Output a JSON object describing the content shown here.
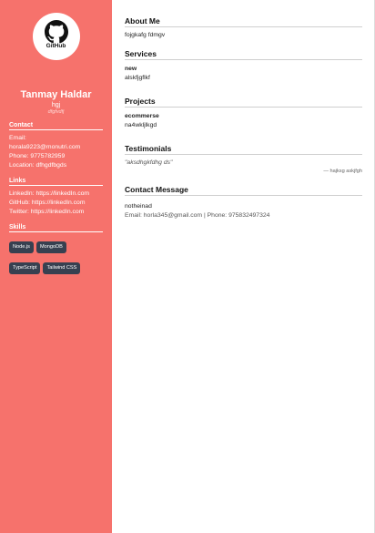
{
  "logo": {
    "text": "GitHub"
  },
  "profile": {
    "name": "Tanmay Haldar",
    "handle": "hgj",
    "subtitle": "dfgfvdfj"
  },
  "contact": {
    "heading": "Contact",
    "email_label": "Email:",
    "email": "horala9223@monutri.com",
    "phone": "Phone: 9775782959",
    "location": "Location: dfhgdfbgds"
  },
  "links": {
    "heading": "Links",
    "linkedin": "LinkedIn: https://linkedIn.com",
    "github": "GitHub: https://linkedIn.com",
    "twitter": "Twitter: https://linkedIn.com"
  },
  "skills": {
    "heading": "Skills",
    "items": [
      "Node.js",
      "MongoDB",
      "TypeScript",
      "Tailwind CSS"
    ]
  },
  "about": {
    "heading": "About Me",
    "text": "fojgkafg fdmgv"
  },
  "services": {
    "heading": "Services",
    "title": "new",
    "text": "alskfjgflkf"
  },
  "projects": {
    "heading": "Projects",
    "title": "ecommerse",
    "text": "na4wkljlkgd"
  },
  "testimonials": {
    "heading": "Testimonials",
    "quote": "\"aksdhgkfdhg ds\"",
    "author": "— hajksg askjfgh"
  },
  "contact_message": {
    "heading": "Contact Message",
    "message": "notheinad",
    "details": "Email: horla345@gmail.com | Phone: 975832497324"
  }
}
